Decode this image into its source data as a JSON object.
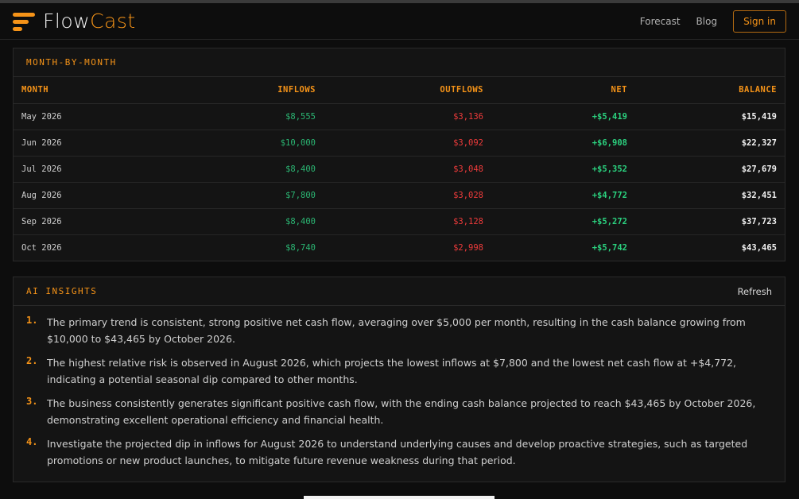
{
  "app": {
    "brand_part1": "Flow",
    "brand_part2": "Cast",
    "accent_color": "#f59318"
  },
  "nav": {
    "forecast_label": "Forecast",
    "blog_label": "Blog",
    "signin_label": "Sign in"
  },
  "monthly": {
    "title": "MONTH-BY-MONTH",
    "columns": [
      "MONTH",
      "INFLOWS",
      "OUTFLOWS",
      "NET",
      "BALANCE"
    ],
    "rows": [
      {
        "month": "May 2026",
        "inflows": "$8,555",
        "outflows": "$3,136",
        "net": "+$5,419",
        "balance": "$15,419"
      },
      {
        "month": "Jun 2026",
        "inflows": "$10,000",
        "outflows": "$3,092",
        "net": "+$6,908",
        "balance": "$22,327"
      },
      {
        "month": "Jul 2026",
        "inflows": "$8,400",
        "outflows": "$3,048",
        "net": "+$5,352",
        "balance": "$27,679"
      },
      {
        "month": "Aug 2026",
        "inflows": "$7,800",
        "outflows": "$3,028",
        "net": "+$4,772",
        "balance": "$32,451"
      },
      {
        "month": "Sep 2026",
        "inflows": "$8,400",
        "outflows": "$3,128",
        "net": "+$5,272",
        "balance": "$37,723"
      },
      {
        "month": "Oct 2026",
        "inflows": "$8,740",
        "outflows": "$2,998",
        "net": "+$5,742",
        "balance": "$43,465"
      }
    ]
  },
  "insights": {
    "title": "AI INSIGHTS",
    "refresh_label": "Refresh",
    "items": [
      {
        "num": "1.",
        "text": "The primary trend is consistent, strong positive net cash flow, averaging over $5,000 per month, resulting in the cash balance growing from $10,000 to $43,465 by October 2026."
      },
      {
        "num": "2.",
        "text": "The highest relative risk is observed in August 2026, which projects the lowest inflows at $7,800 and the lowest net cash flow at +$4,772, indicating a potential seasonal dip compared to other months."
      },
      {
        "num": "3.",
        "text": "The business consistently generates significant positive cash flow, with the ending cash balance projected to reach $43,465 by October 2026, demonstrating excellent operational efficiency and financial health."
      },
      {
        "num": "4.",
        "text": "Investigate the projected dip in inflows for August 2026 to understand underlying causes and develop proactive strategies, such as targeted promotions or new product launches, to mitigate future revenue weakness during that period."
      }
    ]
  }
}
